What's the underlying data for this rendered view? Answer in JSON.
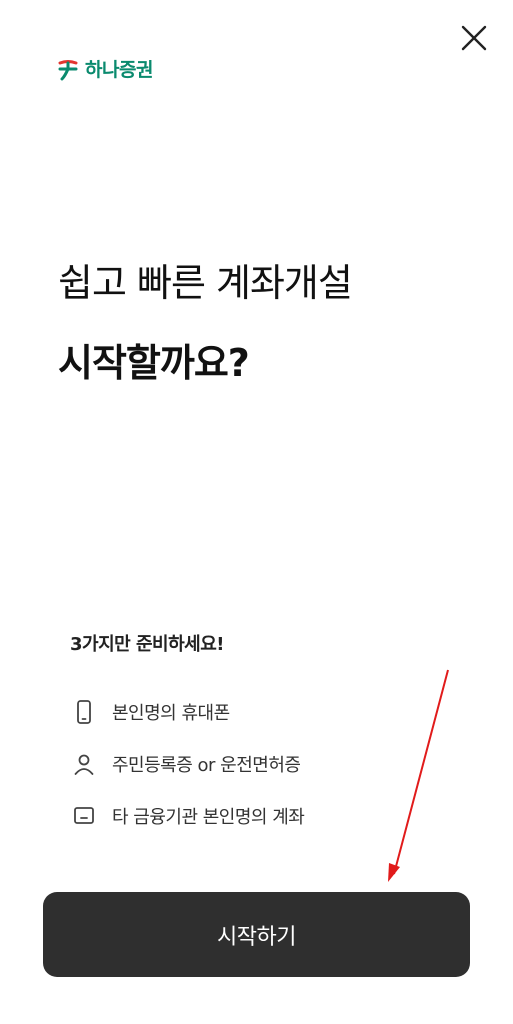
{
  "brand": {
    "name": "하나증권",
    "color": "#0a8a6e"
  },
  "header": {
    "close_icon": "close-icon"
  },
  "headline": {
    "line1": "쉽고 빠른 계좌개설",
    "line2": "시작할까요?"
  },
  "requirements": {
    "title": "3가지만 준비하세요!",
    "items": [
      {
        "icon": "phone-icon",
        "label": "본인명의 휴대폰"
      },
      {
        "icon": "person-icon",
        "label": "주민등록증 or 운전면허증"
      },
      {
        "icon": "bank-card-icon",
        "label": "타 금융기관 본인명의 계좌"
      }
    ]
  },
  "cta": {
    "label": "시작하기",
    "bg_color": "#2f2f2f",
    "text_color": "#ffffff"
  },
  "annotation": {
    "arrow_color": "#e11b1b"
  }
}
